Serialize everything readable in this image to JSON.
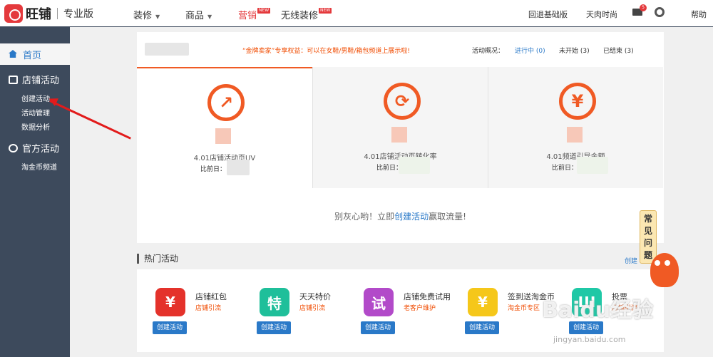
{
  "topbar": {
    "logo_text": "旺铺",
    "edition": "专业版",
    "nav": [
      {
        "label": "装修",
        "caret": "▼"
      },
      {
        "label": "商品",
        "caret": "▼"
      },
      {
        "label": "营销",
        "badge": "NEW"
      },
      {
        "label": "无线装修",
        "badge": "NEW"
      }
    ],
    "links": [
      "回退基础版",
      "天肉时尚",
      "帮助"
    ],
    "mail_count": "5",
    "icons": [
      "mail-icon",
      "gear-icon"
    ]
  },
  "sidebar": {
    "home": "首页",
    "sections": [
      {
        "label": "店铺活动",
        "items": [
          "创建活动",
          "活动管理",
          "数据分析"
        ]
      },
      {
        "label": "官方活动",
        "items": [
          "淘金币频道"
        ]
      }
    ]
  },
  "main": {
    "promo": "“金牌卖家”专享权益：可以在女鞋/男鞋/箱包频道上展示啦!",
    "summary_label": "活动概况：",
    "stats": [
      "进行中 (0)",
      "未开始 (3)",
      "已结束 (3)"
    ],
    "cards": [
      {
        "title": "4.01店铺活动页UV",
        "compare": "比前日：",
        "icon": "trend-icon"
      },
      {
        "title": "4.01店铺活动页转化率",
        "compare": "比前日：",
        "icon": "refresh-icon"
      },
      {
        "title": "4.01频道引导金额",
        "compare": "比前日：",
        "icon": "yen-coin-icon"
      }
    ],
    "empty": {
      "before": "别灰心哟！立即",
      "link": "创建活动",
      "after": "赢取流量!"
    }
  },
  "hot": {
    "title": "热门活动",
    "more": "创建",
    "activities": [
      {
        "name": "店铺红包",
        "tag": "店铺引流",
        "glyph": "¥",
        "color": "#e4322b",
        "button": "创建活动"
      },
      {
        "name": "天天特价",
        "tag": "店铺引流",
        "glyph": "特",
        "color": "#1fbf9a",
        "button": "创建活动"
      },
      {
        "name": "店铺免费试用",
        "tag": "老客户维护",
        "glyph": "试",
        "color": "#b24ac9",
        "button": "创建活动"
      },
      {
        "name": "签到送淘金币",
        "tag": "淘金币专区",
        "glyph": "¥",
        "color": "#f5c71a",
        "button": "创建活动"
      },
      {
        "name": "投票",
        "tag": "店铺引流",
        "glyph": "Ш",
        "color": "#1fc8a6",
        "button": "创建活动"
      }
    ]
  },
  "faq": "常见问题",
  "watermark": {
    "text": "Baidu经验",
    "url": "jingyan.baidu.com"
  }
}
